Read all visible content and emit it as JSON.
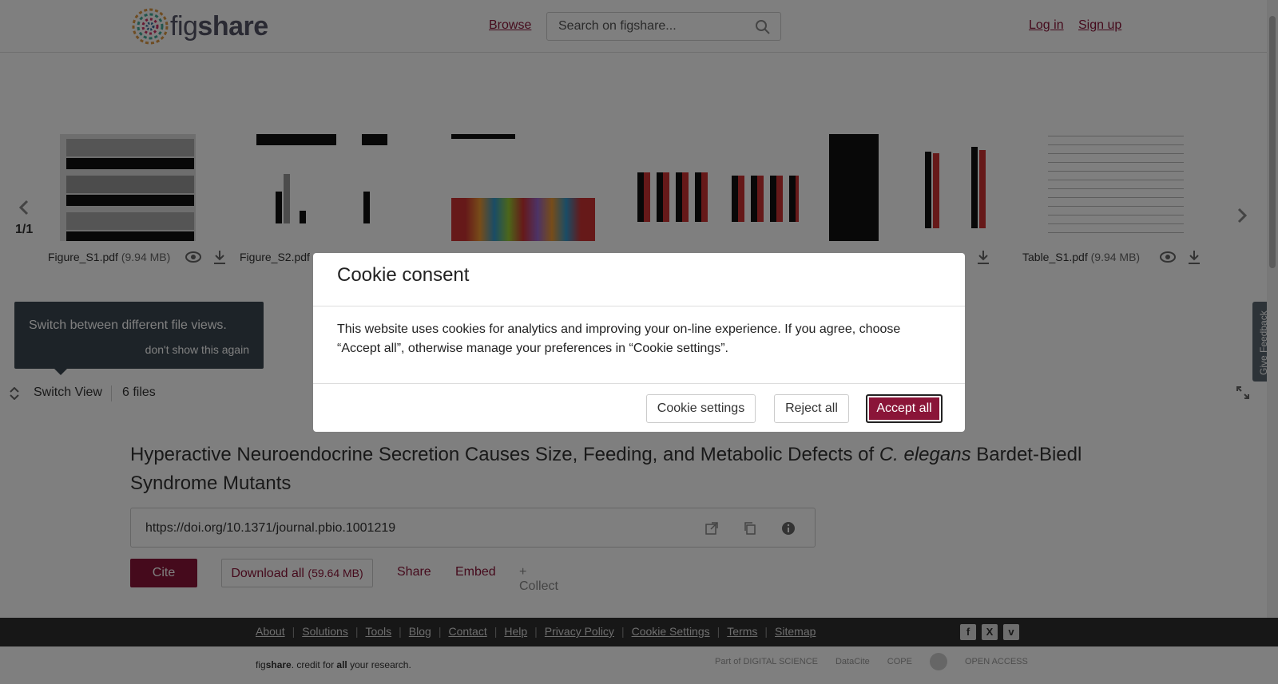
{
  "header": {
    "logo_text_a": "fig",
    "logo_text_b": "share",
    "browse": "Browse",
    "search_placeholder": "Search on figshare...",
    "login": "Log in",
    "signup": "Sign up"
  },
  "viewer": {
    "counter": "1/1",
    "files": [
      {
        "name": "Figure_S1.pdf",
        "size": "(9.94 MB)"
      },
      {
        "name": "Figure_S2.pdf",
        "size": ""
      },
      {
        "name": "",
        "size": ""
      },
      {
        "name": "",
        "size": ""
      },
      {
        "name": "",
        "size": ""
      },
      {
        "name": "Table_S1.pdf",
        "size": "(9.94 MB)"
      }
    ],
    "tooltip_text": "Switch between different file views.",
    "tooltip_dismiss": "don't show this again",
    "switch_view": "Switch View",
    "files_count": "6 files",
    "feedback": "Give Feedback"
  },
  "item": {
    "title_part1": "Hyperactive Neuroendocrine Secretion Causes Size, Feeding, and Metabolic Defects of ",
    "title_italic": "C. elegans",
    "title_part2": " Bardet-Biedl Syndrome Mutants",
    "doi": "https://doi.org/10.1371/journal.pbio.1001219",
    "cite": "Cite",
    "download_all": "Download all",
    "download_size": "(59.64 MB)",
    "share": "Share",
    "embed": "Embed",
    "collect": "+ Collect"
  },
  "footer": {
    "links": [
      "About",
      "Solutions",
      "Tools",
      "Blog",
      "Contact",
      "Help",
      "Privacy Policy",
      "Cookie Settings",
      "Terms",
      "Sitemap"
    ],
    "credit_fig": "fig",
    "credit_share": "share",
    "credit_mid": ". credit for ",
    "credit_all": "all",
    "credit_end": " your research.",
    "partners": [
      "Part of DIGITAL SCIENCE",
      "DataCite",
      "COPE",
      "",
      "OPEN ACCESS"
    ]
  },
  "cookie_modal": {
    "title": "Cookie consent",
    "body": "This website uses cookies for analytics and improving your on-line experience. If you agree, choose “Accept all”, otherwise manage your preferences in “Cookie settings”.",
    "settings_button": "Cookie settings",
    "reject_button": "Reject all",
    "accept_button": "Accept all"
  },
  "colors": {
    "brand": "#8a1538",
    "overlay": "rgba(0,0,0,0.5)",
    "tooltip_bg": "#3a4651"
  }
}
